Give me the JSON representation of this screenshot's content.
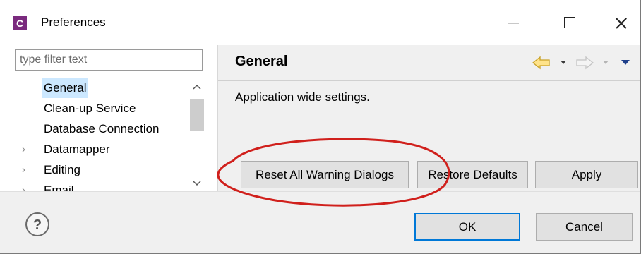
{
  "window": {
    "title": "Preferences",
    "app_icon_letter": "C",
    "app_icon_color": "#7a2a7e"
  },
  "left_pane": {
    "filter_placeholder": "type filter text",
    "tree_items": [
      {
        "label": "General",
        "expandable": false,
        "selected": true
      },
      {
        "label": "Clean-up Service",
        "expandable": false,
        "selected": false
      },
      {
        "label": "Database Connection",
        "expandable": false,
        "selected": false
      },
      {
        "label": "Datamapper",
        "expandable": true,
        "selected": false
      },
      {
        "label": "Editing",
        "expandable": true,
        "selected": false
      },
      {
        "label": "Email",
        "expandable": true,
        "selected": false
      }
    ]
  },
  "right_pane": {
    "title": "General",
    "description": "Application wide settings.",
    "buttons": {
      "reset_warnings": "Reset All Warning Dialogs",
      "restore_defaults": "Restore Defaults",
      "apply": "Apply"
    }
  },
  "footer": {
    "ok": "OK",
    "cancel": "Cancel"
  },
  "colors": {
    "selection": "#cce8ff",
    "nav_back_arrow": "#e8c04a",
    "highlight_ellipse": "#d0201c",
    "default_button_border": "#0078d7"
  },
  "icons": {
    "app": "app-c-icon",
    "help": "help-icon",
    "nav_back": "arrow-left-icon",
    "nav_forward": "arrow-right-icon",
    "view_menu": "triangle-down-icon"
  }
}
